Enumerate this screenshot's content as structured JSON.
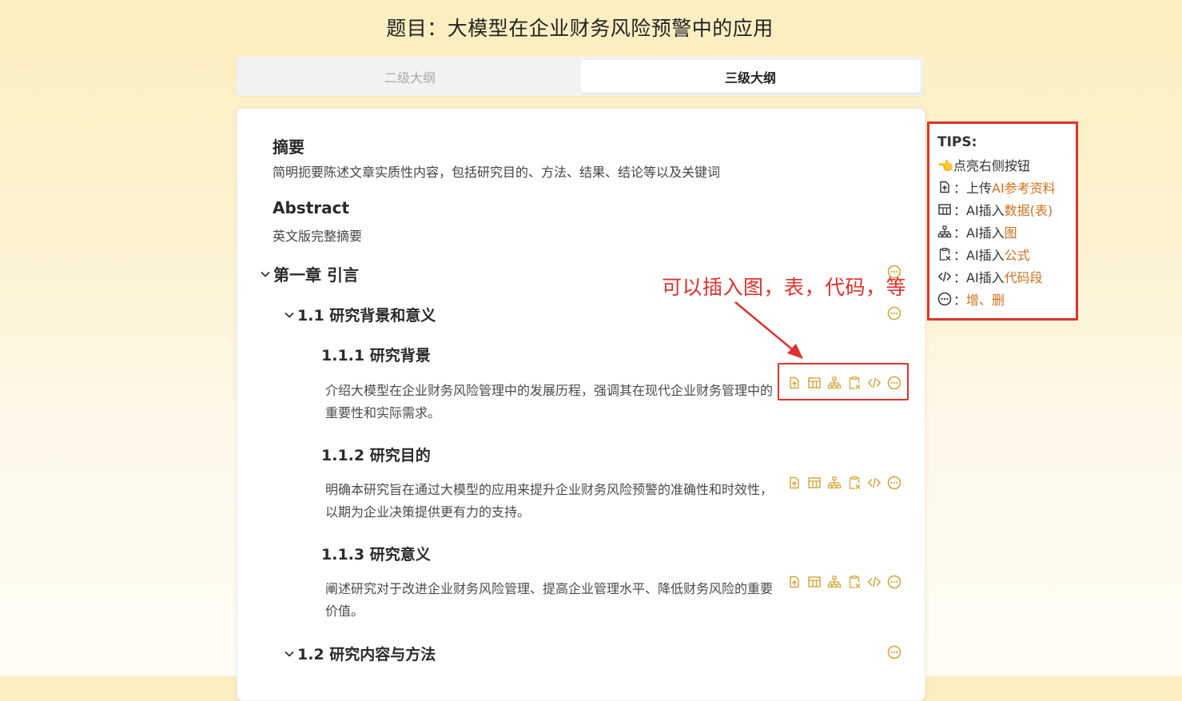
{
  "page": {
    "title": "题目：大模型在企业财务风险预警中的应用"
  },
  "tabs": [
    {
      "label": "二级大纲",
      "active": false
    },
    {
      "label": "三级大纲",
      "active": true
    }
  ],
  "abstract_zh": {
    "title": "摘要",
    "desc": "简明扼要陈述文章实质性内容，包括研究目的、方法、结果、结论等以及关键词"
  },
  "abstract_en": {
    "title": "Abstract",
    "desc": "英文版完整摘要"
  },
  "chapter1": {
    "title": "第一章  引言"
  },
  "section_1_1": {
    "title": "1.1  研究背景和意义"
  },
  "subsections": [
    {
      "title": "1.1.1  研究背景",
      "text": "介绍大模型在企业财务风险管理中的发展历程，强调其在现代企业财务管理中的重要性和实际需求。"
    },
    {
      "title": "1.1.2  研究目的",
      "text": "明确本研究旨在通过大模型的应用来提升企业财务风险预警的准确性和时效性，以期为企业决策提供更有力的支持。"
    },
    {
      "title": "1.1.3  研究意义",
      "text": "阐述研究对于改进企业财务风险管理、提高企业管理水平、降低财务风险的重要价值。"
    }
  ],
  "section_1_2": {
    "title": "1.2  研究内容与方法"
  },
  "annotation": {
    "text": "可以插入图，表，代码，等"
  },
  "tips": {
    "title": "TIPS:",
    "intro": "👈点亮右侧按钮",
    "items": [
      {
        "icon": "upload-file-icon",
        "prefix": "：上传",
        "highlight": "AI参考资料"
      },
      {
        "icon": "table-icon",
        "prefix": "：AI插入",
        "highlight": "数据(表)"
      },
      {
        "icon": "org-chart-icon",
        "prefix": "：AI插入",
        "highlight": "图"
      },
      {
        "icon": "formula-clipboard-icon",
        "prefix": "：AI插入",
        "highlight": "公式"
      },
      {
        "icon": "code-icon",
        "prefix": "：AI插入",
        "highlight": "代码段"
      },
      {
        "icon": "more-circle-icon",
        "prefix": "：",
        "highlight": "增、删"
      }
    ]
  },
  "colors": {
    "accent": "#d4a437",
    "annotation_red": "#e0322c",
    "tip_highlight": "#d0711f"
  }
}
